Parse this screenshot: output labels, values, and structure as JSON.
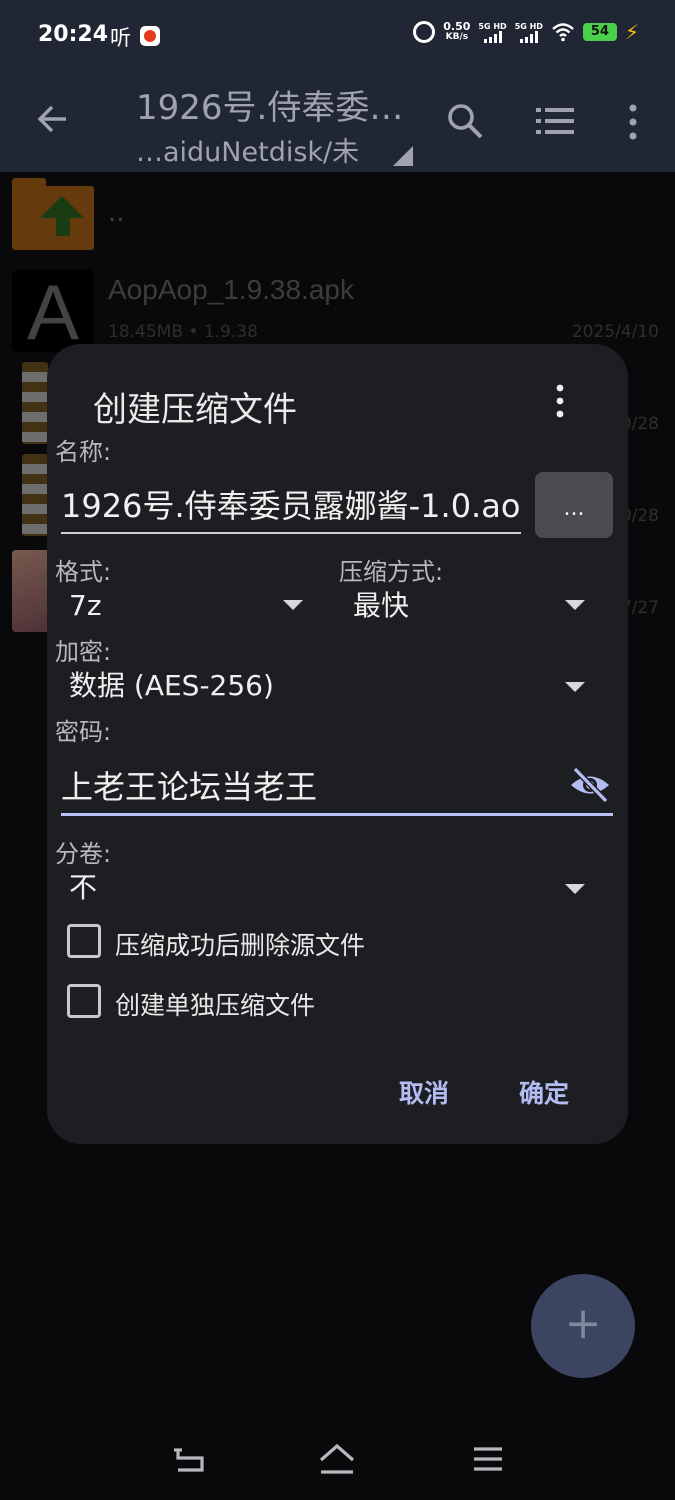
{
  "status_bar": {
    "time": "20:24",
    "ting_label": "听",
    "net_speed_value": "0.50",
    "net_speed_unit": "KB/s",
    "sim1_label": "5G HD",
    "sim2_label": "5G HD",
    "battery": "54"
  },
  "toolbar": {
    "title": "1926号.侍奉委…",
    "path": "…aiduNetdisk/未"
  },
  "file_list": {
    "parent_label": "..",
    "apk": {
      "name": "AopAop_1.9.38.apk",
      "size": "18.45MB",
      "version": "• 1.9.38",
      "date": "2025/4/10",
      "icon_letter": "A"
    },
    "dates_partial": [
      "0/28",
      "0/28",
      "7/27"
    ]
  },
  "dialog": {
    "title": "创建压缩文件",
    "name_label": "名称:",
    "name_value": "1926号.侍奉委员露娜酱-1.0.ao",
    "browse_label": "...",
    "format_label": "格式:",
    "format_value": "7z",
    "method_label": "压缩方式:",
    "method_value": "最快",
    "encrypt_label": "加密:",
    "encrypt_value": "数据 (AES-256)",
    "password_label": "密码:",
    "password_value": "上老王论坛当老王",
    "split_label": "分卷:",
    "split_value": "不",
    "delete_source_label": "压缩成功后删除源文件",
    "delete_source_checked": false,
    "separate_archive_label": "创建单独压缩文件",
    "separate_archive_checked": false,
    "cancel_label": "取消",
    "ok_label": "确定"
  },
  "fab": {
    "label": "+"
  },
  "colors": {
    "bar_bg": "#202634",
    "dialog_bg": "#1d1e22",
    "accent": "#b3bdf3",
    "fab_bg": "#3b4460"
  }
}
